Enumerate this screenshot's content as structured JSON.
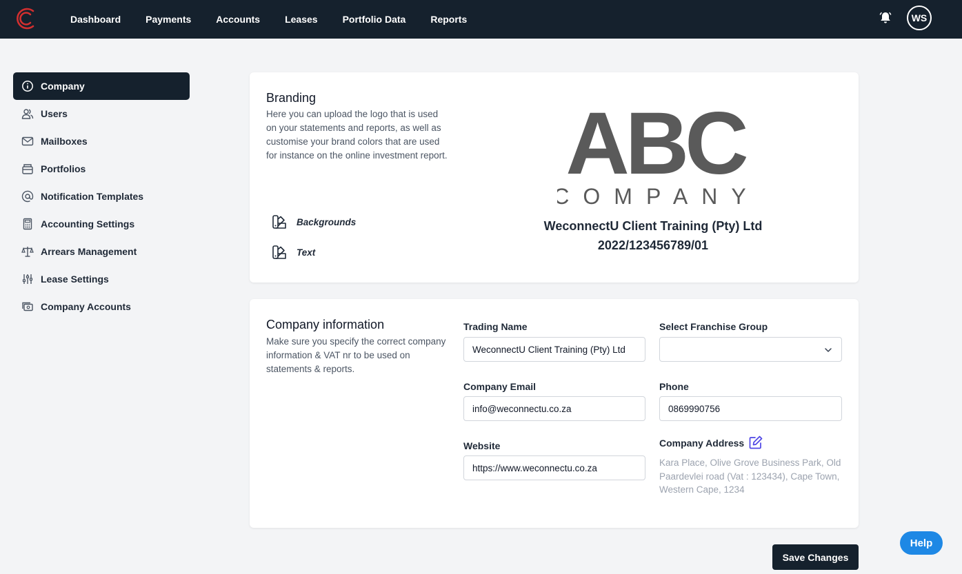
{
  "nav": {
    "items": [
      {
        "label": "Dashboard",
        "name": "nav-dashboard"
      },
      {
        "label": "Payments",
        "name": "nav-payments"
      },
      {
        "label": "Accounts",
        "name": "nav-accounts"
      },
      {
        "label": "Leases",
        "name": "nav-leases"
      },
      {
        "label": "Portfolio Data",
        "name": "nav-portfolio-data"
      },
      {
        "label": "Reports",
        "name": "nav-reports"
      }
    ],
    "avatar_initials": "WS",
    "logo_icon": "company-logo-icon",
    "bell_icon": "bell-icon"
  },
  "sidebar": {
    "items": [
      {
        "label": "Company",
        "icon": "info-icon",
        "active": true
      },
      {
        "label": "Users",
        "icon": "users-icon",
        "active": false
      },
      {
        "label": "Mailboxes",
        "icon": "mail-icon",
        "active": false
      },
      {
        "label": "Portfolios",
        "icon": "portfolio-icon",
        "active": false
      },
      {
        "label": "Notification Templates",
        "icon": "at-icon",
        "active": false
      },
      {
        "label": "Accounting Settings",
        "icon": "calculator-icon",
        "active": false
      },
      {
        "label": "Arrears Management",
        "icon": "scale-icon",
        "active": false
      },
      {
        "label": "Lease Settings",
        "icon": "sliders-icon",
        "active": false
      },
      {
        "label": "Company Accounts",
        "icon": "accounts-icon",
        "active": false
      }
    ]
  },
  "branding": {
    "title": "Branding",
    "description": "Here you can upload the logo that is used on your statements and reports, as well as customise your brand colors that are used for instance on the online investment report.",
    "options": [
      {
        "label": "Backgrounds",
        "icon": "palette-icon"
      },
      {
        "label": "Text",
        "icon": "palette-icon"
      }
    ],
    "logo_main": "ABC",
    "logo_sub": "COMPANY",
    "company_name": "WeconnectU Client Training (Pty) Ltd",
    "registration_number": "2022/123456789/01"
  },
  "company_info": {
    "title": "Company information",
    "description": "Make sure you specify the correct company information & VAT nr to be used on statements & reports.",
    "trading_name_label": "Trading Name",
    "trading_name_value": "WeconnectU Client Training (Pty) Ltd",
    "franchise_label": "Select Franchise Group",
    "franchise_value": "",
    "email_label": "Company Email",
    "email_value": "info@weconnectu.co.za",
    "phone_label": "Phone",
    "phone_value": "0869990756",
    "website_label": "Website",
    "website_value": "https://www.weconnectu.co.za",
    "address_label": "Company Address",
    "address_value": "Kara Place, Olive Grove Business Park, Old Paardevlei road (Vat : 123434), Cape Town, Western Cape, 1234"
  },
  "actions": {
    "save_label": "Save Changes",
    "help_label": "Help"
  },
  "colors": {
    "nav_bg": "#15212d",
    "brand_red": "#d32f2f",
    "logo_gray": "#5a5a5a",
    "help_blue": "#1e88e5",
    "edit_purple": "#4f46e5"
  }
}
